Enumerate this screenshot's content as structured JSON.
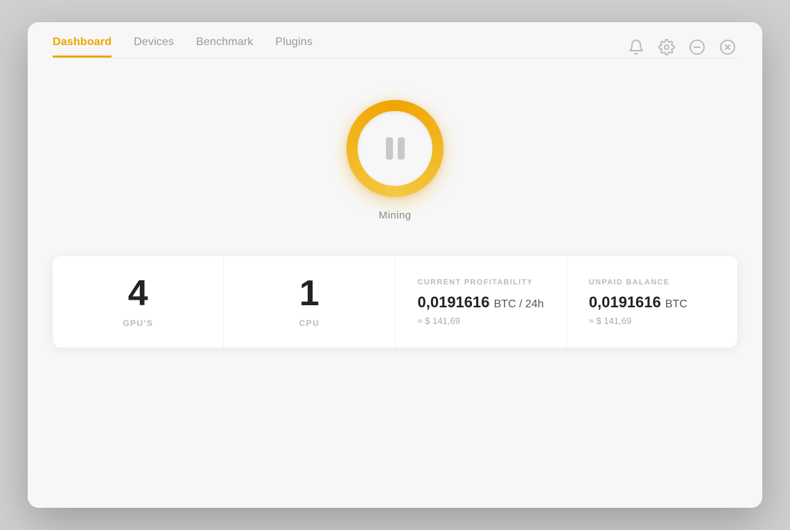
{
  "nav": {
    "items": [
      {
        "id": "dashboard",
        "label": "Dashboard",
        "active": true
      },
      {
        "id": "devices",
        "label": "Devices",
        "active": false
      },
      {
        "id": "benchmark",
        "label": "Benchmark",
        "active": false
      },
      {
        "id": "plugins",
        "label": "Plugins",
        "active": false
      }
    ]
  },
  "window_controls": {
    "notification_icon": "🔔",
    "settings_icon": "⚙",
    "minimize_icon": "⊖",
    "close_icon": "⊗"
  },
  "mining": {
    "status_label": "Mining",
    "button_state": "paused"
  },
  "stats": {
    "gpus": {
      "count": "4",
      "label": "GPU'S"
    },
    "cpu": {
      "count": "1",
      "label": "CPU"
    },
    "profitability": {
      "section_label": "CURRENT PROFITABILITY",
      "value": "0,0191616",
      "unit": "BTC / 24h",
      "usd_approx": "≈ $ 141,69"
    },
    "balance": {
      "section_label": "UNPAID BALANCE",
      "value": "0,0191616",
      "unit": "BTC",
      "usd_approx": "≈ $ 141,69"
    }
  },
  "colors": {
    "accent": "#f0a500",
    "accent_light": "#f5c842",
    "text_primary": "#222",
    "text_secondary": "#888",
    "text_muted": "#bbb"
  }
}
